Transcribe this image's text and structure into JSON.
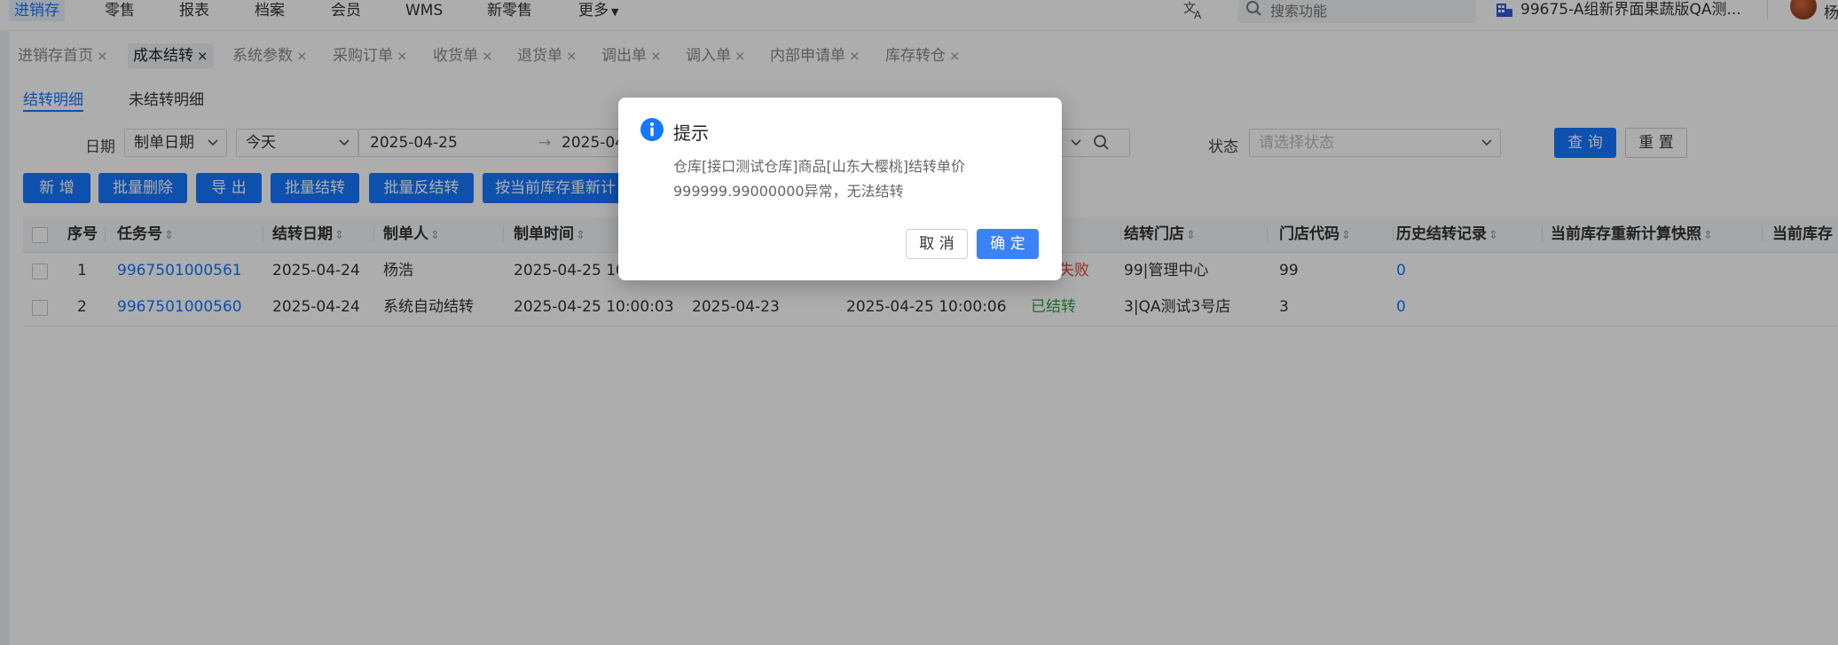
{
  "topnav": {
    "items": [
      "进销存",
      "零售",
      "报表",
      "档案",
      "会员",
      "WMS",
      "新零售",
      "更多"
    ],
    "search_placeholder": "搜索功能",
    "store": "99675-A组新界面果蔬版QA测...",
    "user": "杨"
  },
  "tabs": [
    "进销存首页",
    "成本结转",
    "系统参数",
    "采购订单",
    "收货单",
    "退货单",
    "调出单",
    "调入单",
    "内部申请单",
    "库存转仓"
  ],
  "close_glyph": "×",
  "subtabs": [
    "结转明细",
    "未结转明细"
  ],
  "filters": {
    "date_label": "日期",
    "date_type": "制单日期",
    "date_preset": "今天",
    "date_start": "2025-04-25",
    "date_sep": "→",
    "date_end": "2025-04",
    "status_label": "状态",
    "status_placeholder": "请选择状态",
    "query": "查 询",
    "reset": "重 置"
  },
  "toolbar": {
    "new": "新 增",
    "batch_delete": "批量删除",
    "export": "导 出",
    "batch_carry": "批量结转",
    "batch_reverse": "批量反结转",
    "recalc": "按当前库存重新计"
  },
  "table": {
    "headers": [
      "序号",
      "任务号",
      "结转日期",
      "制单人",
      "制单时间",
      "结转门店",
      "门店代码",
      "历史结转记录",
      "当前库存重新计算快照",
      "当前库存"
    ],
    "rows": [
      {
        "seq": "1",
        "task": "9967501000561",
        "date": "2025-04-24",
        "maker": "杨浩",
        "time": "2025-04-25 10:",
        "col6": "",
        "col7": "",
        "status": "失败",
        "store": "99|管理中心",
        "code": "99",
        "history": "0"
      },
      {
        "seq": "2",
        "task": "9967501000560",
        "date": "2025-04-24",
        "maker": "系统自动结转",
        "time": "2025-04-25 10:00:03",
        "col6": "2025-04-23",
        "col7": "2025-04-25 10:00:06",
        "status": "已结转",
        "store": "3|QA测试3号店",
        "code": "3",
        "history": "0"
      }
    ]
  },
  "modal": {
    "title": "提示",
    "message": "仓库[接口测试仓库]商品[山东大樱桃]结转单价999999.99000000异常，无法结转",
    "cancel": "取 消",
    "ok": "确 定"
  },
  "colors": {
    "primary": "#1677ff",
    "success": "#2ea043",
    "danger": "#e0463c"
  },
  "icons": [
    "translate-icon",
    "search-icon",
    "building-icon",
    "chevron-down-icon",
    "info-icon",
    "close-icon",
    "sort-icon",
    "checkbox"
  ]
}
